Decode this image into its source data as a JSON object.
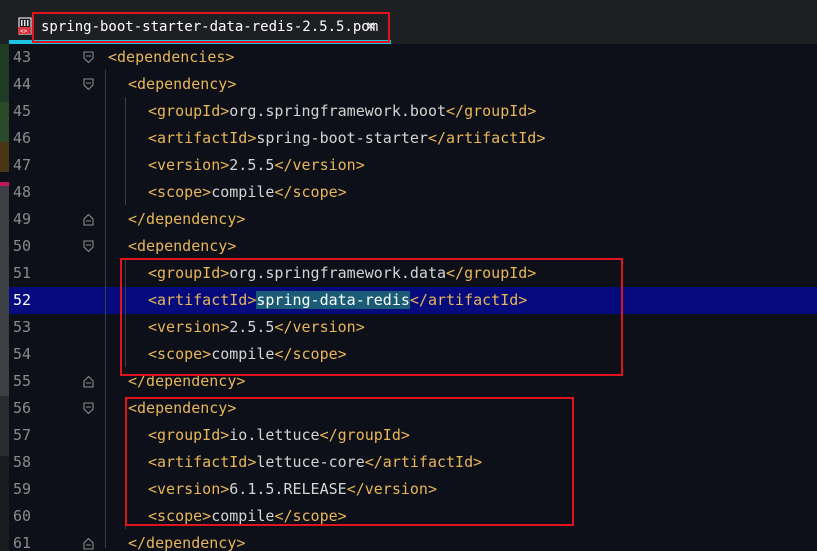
{
  "tab": {
    "title": "spring-boot-starter-data-redis-2.5.5.pom",
    "close_glyph": "×",
    "icon": "xml-file-icon",
    "highlight_color": "#e0141e",
    "active_underline_color": "#1ec3e3"
  },
  "editor": {
    "current_line": "52",
    "selected_text": "spring-data-redis",
    "lines": [
      {
        "num": "43",
        "indent": 0,
        "fold": "open",
        "open": "<dependencies>",
        "value": "",
        "close": ""
      },
      {
        "num": "44",
        "indent": 1,
        "fold": "open",
        "open": "<dependency>",
        "value": "",
        "close": ""
      },
      {
        "num": "45",
        "indent": 2,
        "fold": "",
        "open": "<groupId>",
        "value": "org.springframework.boot",
        "close": "</groupId>"
      },
      {
        "num": "46",
        "indent": 2,
        "fold": "",
        "open": "<artifactId>",
        "value": "spring-boot-starter",
        "close": "</artifactId>"
      },
      {
        "num": "47",
        "indent": 2,
        "fold": "",
        "open": "<version>",
        "value": "2.5.5",
        "close": "</version>"
      },
      {
        "num": "48",
        "indent": 2,
        "fold": "",
        "open": "<scope>",
        "value": "compile",
        "close": "</scope>"
      },
      {
        "num": "49",
        "indent": 1,
        "fold": "close",
        "open": "</dependency>",
        "value": "",
        "close": ""
      },
      {
        "num": "50",
        "indent": 1,
        "fold": "open",
        "open": "<dependency>",
        "value": "",
        "close": ""
      },
      {
        "num": "51",
        "indent": 2,
        "fold": "",
        "open": "<groupId>",
        "value": "org.springframework.data",
        "close": "</groupId>"
      },
      {
        "num": "52",
        "indent": 2,
        "fold": "",
        "open": "<artifactId>",
        "value": "spring-data-redis",
        "close": "</artifactId>"
      },
      {
        "num": "53",
        "indent": 2,
        "fold": "",
        "open": "<version>",
        "value": "2.5.5",
        "close": "</version>"
      },
      {
        "num": "54",
        "indent": 2,
        "fold": "",
        "open": "<scope>",
        "value": "compile",
        "close": "</scope>"
      },
      {
        "num": "55",
        "indent": 1,
        "fold": "close",
        "open": "</dependency>",
        "value": "",
        "close": ""
      },
      {
        "num": "56",
        "indent": 1,
        "fold": "open",
        "open": "<dependency>",
        "value": "",
        "close": ""
      },
      {
        "num": "57",
        "indent": 2,
        "fold": "",
        "open": "<groupId>",
        "value": "io.lettuce",
        "close": "</groupId>"
      },
      {
        "num": "58",
        "indent": 2,
        "fold": "",
        "open": "<artifactId>",
        "value": "lettuce-core",
        "close": "</artifactId>"
      },
      {
        "num": "59",
        "indent": 2,
        "fold": "",
        "open": "<version>",
        "value": "6.1.5.RELEASE",
        "close": "</version>"
      },
      {
        "num": "60",
        "indent": 2,
        "fold": "",
        "open": "<scope>",
        "value": "compile",
        "close": "</scope>"
      },
      {
        "num": "61",
        "indent": 1,
        "fold": "close",
        "open": "</dependency>",
        "value": "",
        "close": ""
      }
    ]
  },
  "colors": {
    "background": "#0d1018",
    "tag": "#e8b659",
    "text": "#d4d4d4",
    "line_number": "#8b8b8b",
    "current_line": "#050a7c",
    "selection": "#1a5c75"
  }
}
